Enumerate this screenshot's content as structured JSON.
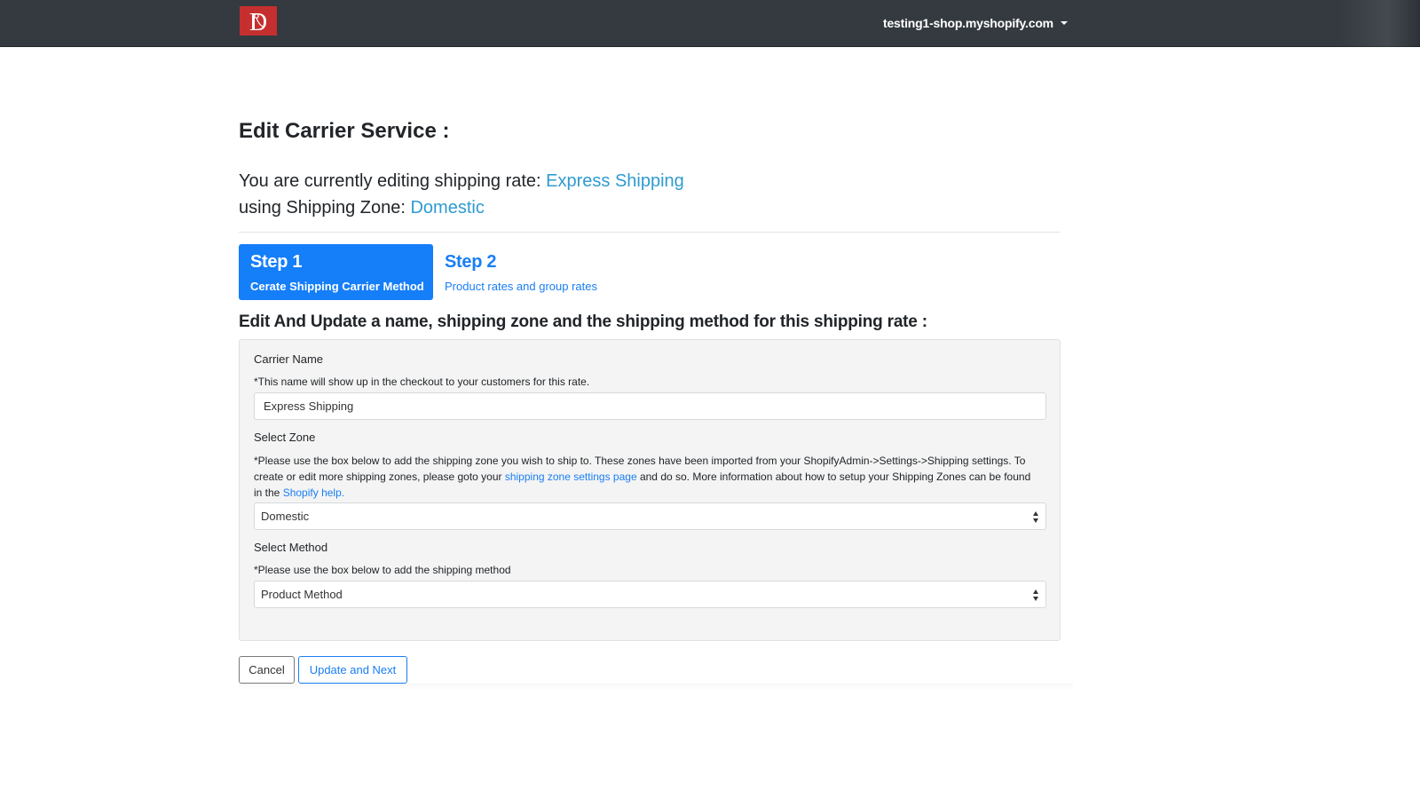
{
  "navbar": {
    "logo_icon": "brand-d-logo",
    "account": "testing1-shop.myshopify.com",
    "account_caret_icon": "caret-down-icon",
    "colors": {
      "background": "#343a40",
      "logo": "#c62f2f"
    }
  },
  "page": {
    "title": "Edit Carrier Service :",
    "editing_prefix": "You are currently editing shipping rate: ",
    "rate_name": "Express Shipping",
    "zone_prefix": "using Shipping Zone: ",
    "zone_name": "Domestic",
    "highlight_color": "#2f9bd0"
  },
  "steps": [
    {
      "title": "Step 1",
      "subtitle": "Cerate Shipping Carrier Method",
      "active": true
    },
    {
      "title": "Step 2",
      "subtitle": "Product rates and group rates",
      "active": false
    }
  ],
  "form": {
    "heading": "Edit And Update a name, shipping zone and the shipping method for this shipping rate :",
    "carrier_name": {
      "label": "Carrier Name",
      "help": "*This name will show up in the checkout to your customers for this rate.",
      "value": "Express Shipping"
    },
    "zone": {
      "label": "Select Zone",
      "help_part1": "*Please use the box below to add the shipping zone you wish to ship to. These zones have been imported from your ShopifyAdmin->Settings->Shipping settings. To create or edit more shipping zones, please goto your ",
      "help_link1": "shipping zone settings page",
      "help_part2": " and do so. More information about how to setup your Shipping Zones can be found in the ",
      "help_link2": "Shopify help.",
      "selected": "Domestic"
    },
    "method": {
      "label": "Select Method",
      "help": "*Please use the box below to add the shipping method",
      "selected": "Product Method"
    }
  },
  "actions": {
    "cancel": "Cancel",
    "update_next": "Update and Next",
    "accent_color": "#1a7ef5"
  }
}
